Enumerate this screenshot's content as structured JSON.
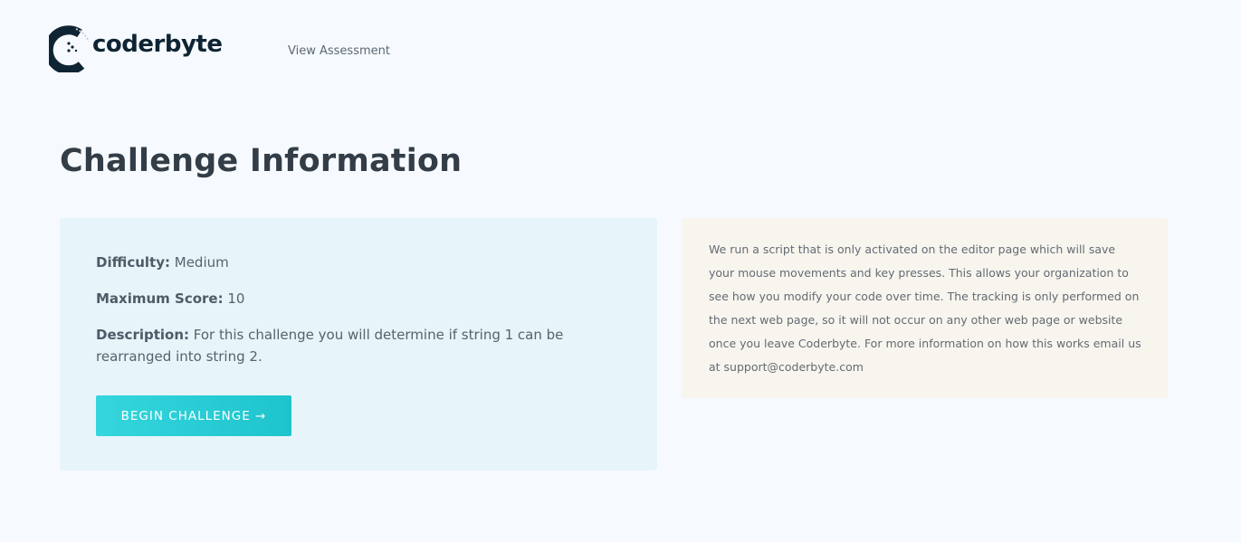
{
  "header": {
    "brand": "coderbyte",
    "nav_link": "View Assessment"
  },
  "page": {
    "title": "Challenge Information"
  },
  "challenge": {
    "difficulty_label": "Difficulty:",
    "difficulty_value": " Medium",
    "score_label": "Maximum Score:",
    "score_value": " 10",
    "description_label": "Description:",
    "description_value": " For this challenge you will determine if string 1 can be rearranged into string 2.",
    "begin_button": "BEGIN CHALLENGE →"
  },
  "notice": {
    "text": "We run a script that is only activated on the editor page which will save your mouse movements and key presses. This allows your organization to see how you modify your code over time. The tracking is only performed on the next web page, so it will not occur on any other web page or website once you leave Coderbyte. For more information on how this works email us at support@coderbyte.com"
  },
  "colors": {
    "brand_dark": "#0e2433",
    "button_accent": "#22c7cf",
    "info_card_bg": "#e7f5fa",
    "notice_card_bg": "#f8f5ef"
  },
  "icons": {
    "logo": "coderbyte-logo-icon"
  }
}
